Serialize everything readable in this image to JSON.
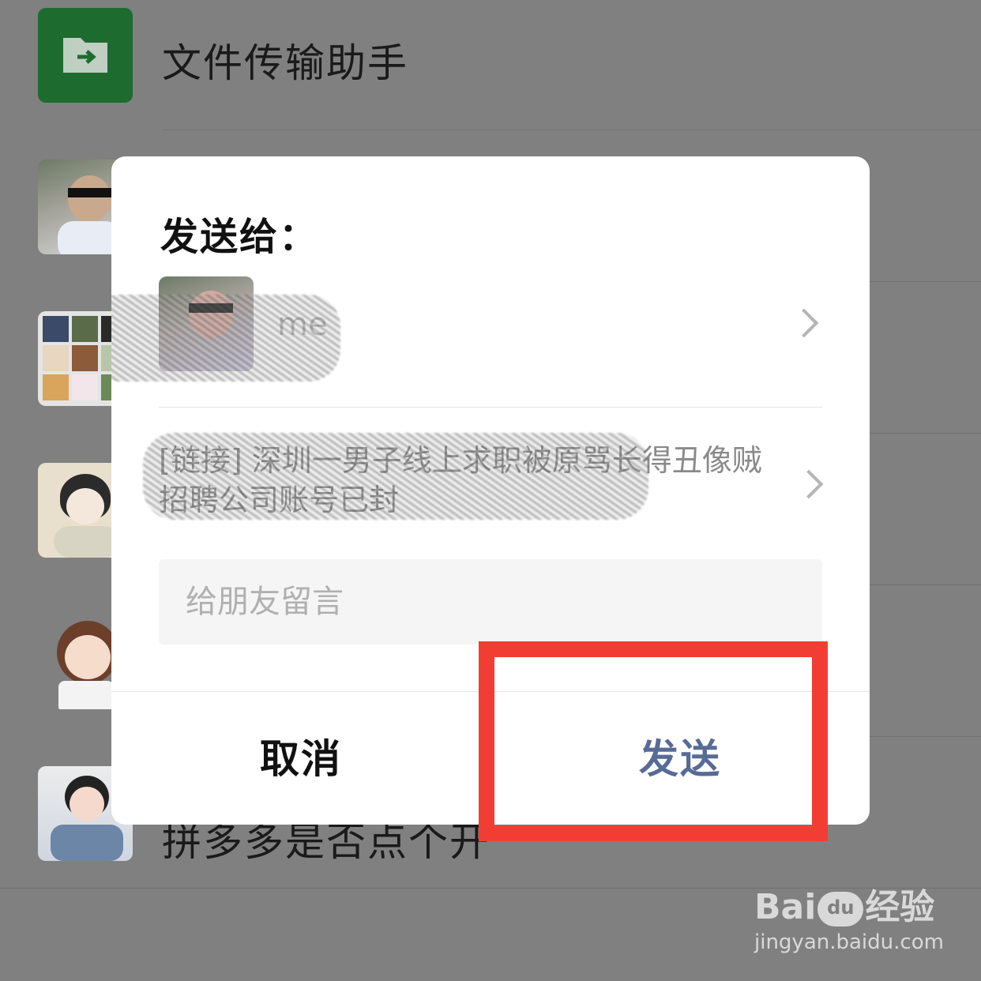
{
  "chat_list": {
    "items": [
      {
        "name": "文件传输助手",
        "icon": "folder-forward-icon"
      },
      {
        "name": "",
        "icon": "contact-avatar"
      },
      {
        "name": "",
        "icon": "group-avatar"
      },
      {
        "name": "",
        "icon": "contact-avatar"
      },
      {
        "name": "",
        "icon": "contact-avatar"
      },
      {
        "name": "拼多多是否点个开",
        "icon": "contact-avatar"
      }
    ]
  },
  "dialog": {
    "title": "发送给：",
    "recipient": {
      "name": "me"
    },
    "link_preview": "[链接] 深圳一男子线上求职被原骂长得丑像贼 招聘公司账号已封",
    "message_placeholder": "给朋友留言",
    "cancel_label": "取消",
    "send_label": "发送"
  },
  "watermark": {
    "logo": "Bai",
    "logo_paw": "du",
    "logo_suffix": "经验",
    "url": "jingyan.baidu.com"
  },
  "colors": {
    "overlay_bg": "#808080",
    "send_accent": "#576b95",
    "highlight": "#f23d34",
    "file_helper_green": "#1e6b2f"
  }
}
